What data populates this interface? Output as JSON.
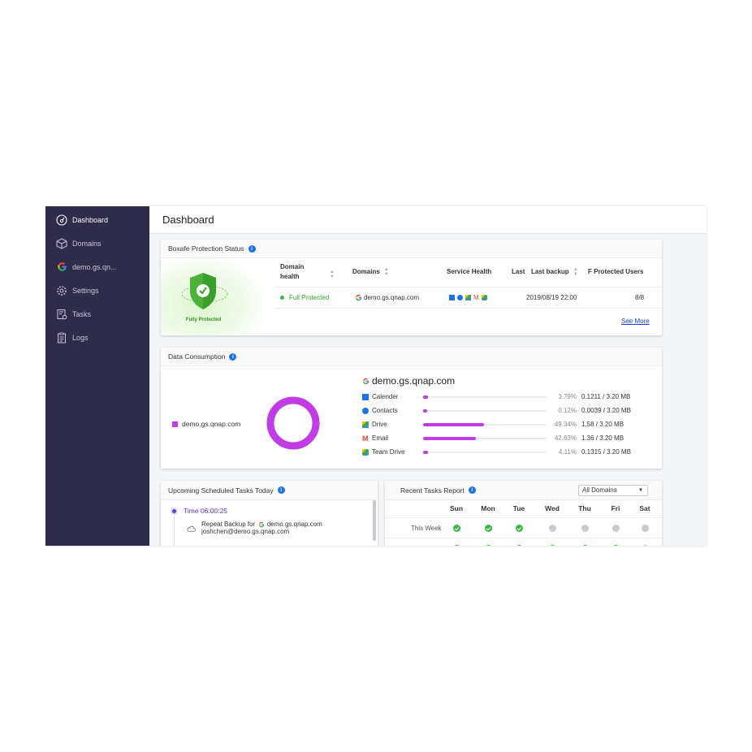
{
  "sidebar": {
    "items": [
      {
        "label": "Dashboard",
        "icon": "dashboard-icon",
        "active": true
      },
      {
        "label": "Domains",
        "icon": "cube-icon"
      },
      {
        "label": "demo.gs.qn...",
        "icon": "google-icon"
      },
      {
        "label": "Settings",
        "icon": "gear-icon"
      },
      {
        "label": "Tasks",
        "icon": "tasks-icon"
      },
      {
        "label": "Logs",
        "icon": "clipboard-icon"
      }
    ]
  },
  "header": {
    "title": "Dashboard"
  },
  "protection": {
    "title": "Boxafe Protection Status",
    "badge_label": "Fully Protected",
    "columns": {
      "domain_health": "Domain health",
      "domains": "Domains",
      "service_health": "Service Health",
      "last": "Last",
      "last_backup": "Last backup",
      "protected_users": "F Protected Users"
    },
    "rows": [
      {
        "health": "Full Protected",
        "domain": "demo.gs.qnap.com",
        "last_backup": "2019/08/19 22:00",
        "protected_users": "8/8"
      }
    ],
    "see_more": "See More"
  },
  "data_consumption": {
    "title": "Data Consumption",
    "legend_domain": "demo.gs.qnap.com",
    "domain_title": "demo.gs.qnap.com",
    "accent": "#c13be6",
    "services": [
      {
        "label": "Calender",
        "icon": "calendar-icon",
        "percent": "3.79%",
        "fraction": 0.0379,
        "size": "0.1211 / 3.20 MB"
      },
      {
        "label": "Contacts",
        "icon": "contacts-icon",
        "percent": "0.12%",
        "fraction": 0.0012,
        "size": "0.0039 / 3.20 MB"
      },
      {
        "label": "Drive",
        "icon": "drive-icon",
        "percent": "49.34%",
        "fraction": 0.4934,
        "size": "1.58 / 3.20 MB"
      },
      {
        "label": "Email",
        "icon": "gmail-icon",
        "percent": "42.63%",
        "fraction": 0.4263,
        "size": "1.36 / 3.20 MB"
      },
      {
        "label": "Team Drive",
        "icon": "team-drive-icon",
        "percent": "4.11%",
        "fraction": 0.0411,
        "size": "0.1315 / 3.20 MB"
      }
    ]
  },
  "upcoming": {
    "title": "Upcoming Scheduled Tasks Today",
    "time": "Time 06:00:25",
    "task_prefix": "Repeat Backup for",
    "task_domain": "demo.gs.qnap.com",
    "task_user": "joshchen@demo.gs.qnap.com"
  },
  "recent": {
    "title": "Recent Tasks Report",
    "filter_value": "All Domains",
    "days": [
      "Sun",
      "Mon",
      "Tue",
      "Wed",
      "Thu",
      "Fri",
      "Sat"
    ],
    "rows": [
      {
        "label": "This Week",
        "status": [
          "ok",
          "ok",
          "ok",
          "none",
          "none",
          "none",
          "none"
        ]
      },
      {
        "label": "",
        "status": [
          "ok",
          "ok",
          "ok",
          "ok",
          "ok",
          "ok",
          "none"
        ]
      }
    ]
  }
}
